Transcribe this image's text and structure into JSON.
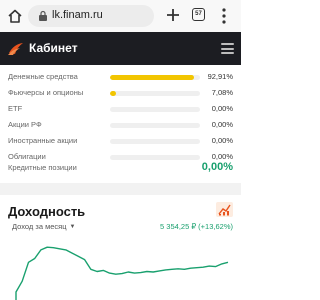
{
  "browser": {
    "url": "lk.finam.ru",
    "tab_count": "57"
  },
  "header": {
    "title": "Кабинет"
  },
  "allocation": [
    {
      "label": "Денежные средства",
      "value": "92,91%",
      "fraction": 0.9291
    },
    {
      "label": "Фьючерсы и опционы",
      "value": "7,08%",
      "fraction": 0.0708
    },
    {
      "label": "ETF",
      "value": "0,00%",
      "fraction": 0
    },
    {
      "label": "Акции РФ",
      "value": "0,00%",
      "fraction": 0
    },
    {
      "label": "Иностранные акции",
      "value": "0,00%",
      "fraction": 0
    },
    {
      "label": "Облигации",
      "value": "0,00%",
      "fraction": 0
    }
  ],
  "credit": {
    "label": "Кредитные позиции",
    "value": "0,00%"
  },
  "income": {
    "title": "Доходность",
    "period": "Доход за месяц",
    "profit": "5 354,25 ₽ (+13,62%)"
  },
  "colors": {
    "accent_yellow": "#f2c500",
    "positive_green": "#19a06e",
    "header_bg": "#1c1d22",
    "brand_orange": "#e8531e"
  },
  "chart_data": {
    "type": "line",
    "series": [
      {
        "values": [
          0.0,
          0.2,
          0.55,
          0.62,
          0.78,
          0.83,
          0.82,
          0.8,
          0.78,
          0.72,
          0.66,
          0.6,
          0.42,
          0.38,
          0.4,
          0.35,
          0.33,
          0.34,
          0.37,
          0.35,
          0.36,
          0.38,
          0.37,
          0.39,
          0.41,
          0.42,
          0.43,
          0.42,
          0.44,
          0.45,
          0.46,
          0.48,
          0.47,
          0.52,
          0.55
        ]
      }
    ]
  }
}
